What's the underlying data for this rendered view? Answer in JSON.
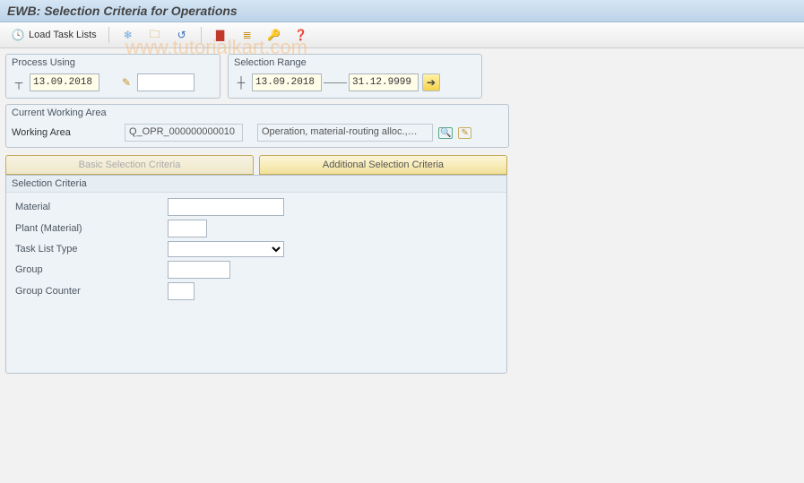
{
  "title": "EWB: Selection Criteria for Operations",
  "watermark": "www.tutorialkart.com",
  "toolbar": {
    "load_label": "Load Task Lists"
  },
  "process_using": {
    "title": "Process Using",
    "date": "13.09.2018"
  },
  "selection_range": {
    "title": "Selection Range",
    "from": "13.09.2018",
    "to": "31.12.9999"
  },
  "working_area": {
    "title": "Current Working Area",
    "label": "Working Area",
    "id": "Q_OPR_000000000010",
    "desc": "Operation, material-routing alloc.,…"
  },
  "tabs": {
    "basic": "Basic Selection Criteria",
    "additional": "Additional Selection Criteria"
  },
  "criteria": {
    "title": "Selection Criteria",
    "material": "Material",
    "plant": "Plant (Material)",
    "task_list_type": "Task List Type",
    "group": "Group",
    "group_counter": "Group Counter"
  }
}
